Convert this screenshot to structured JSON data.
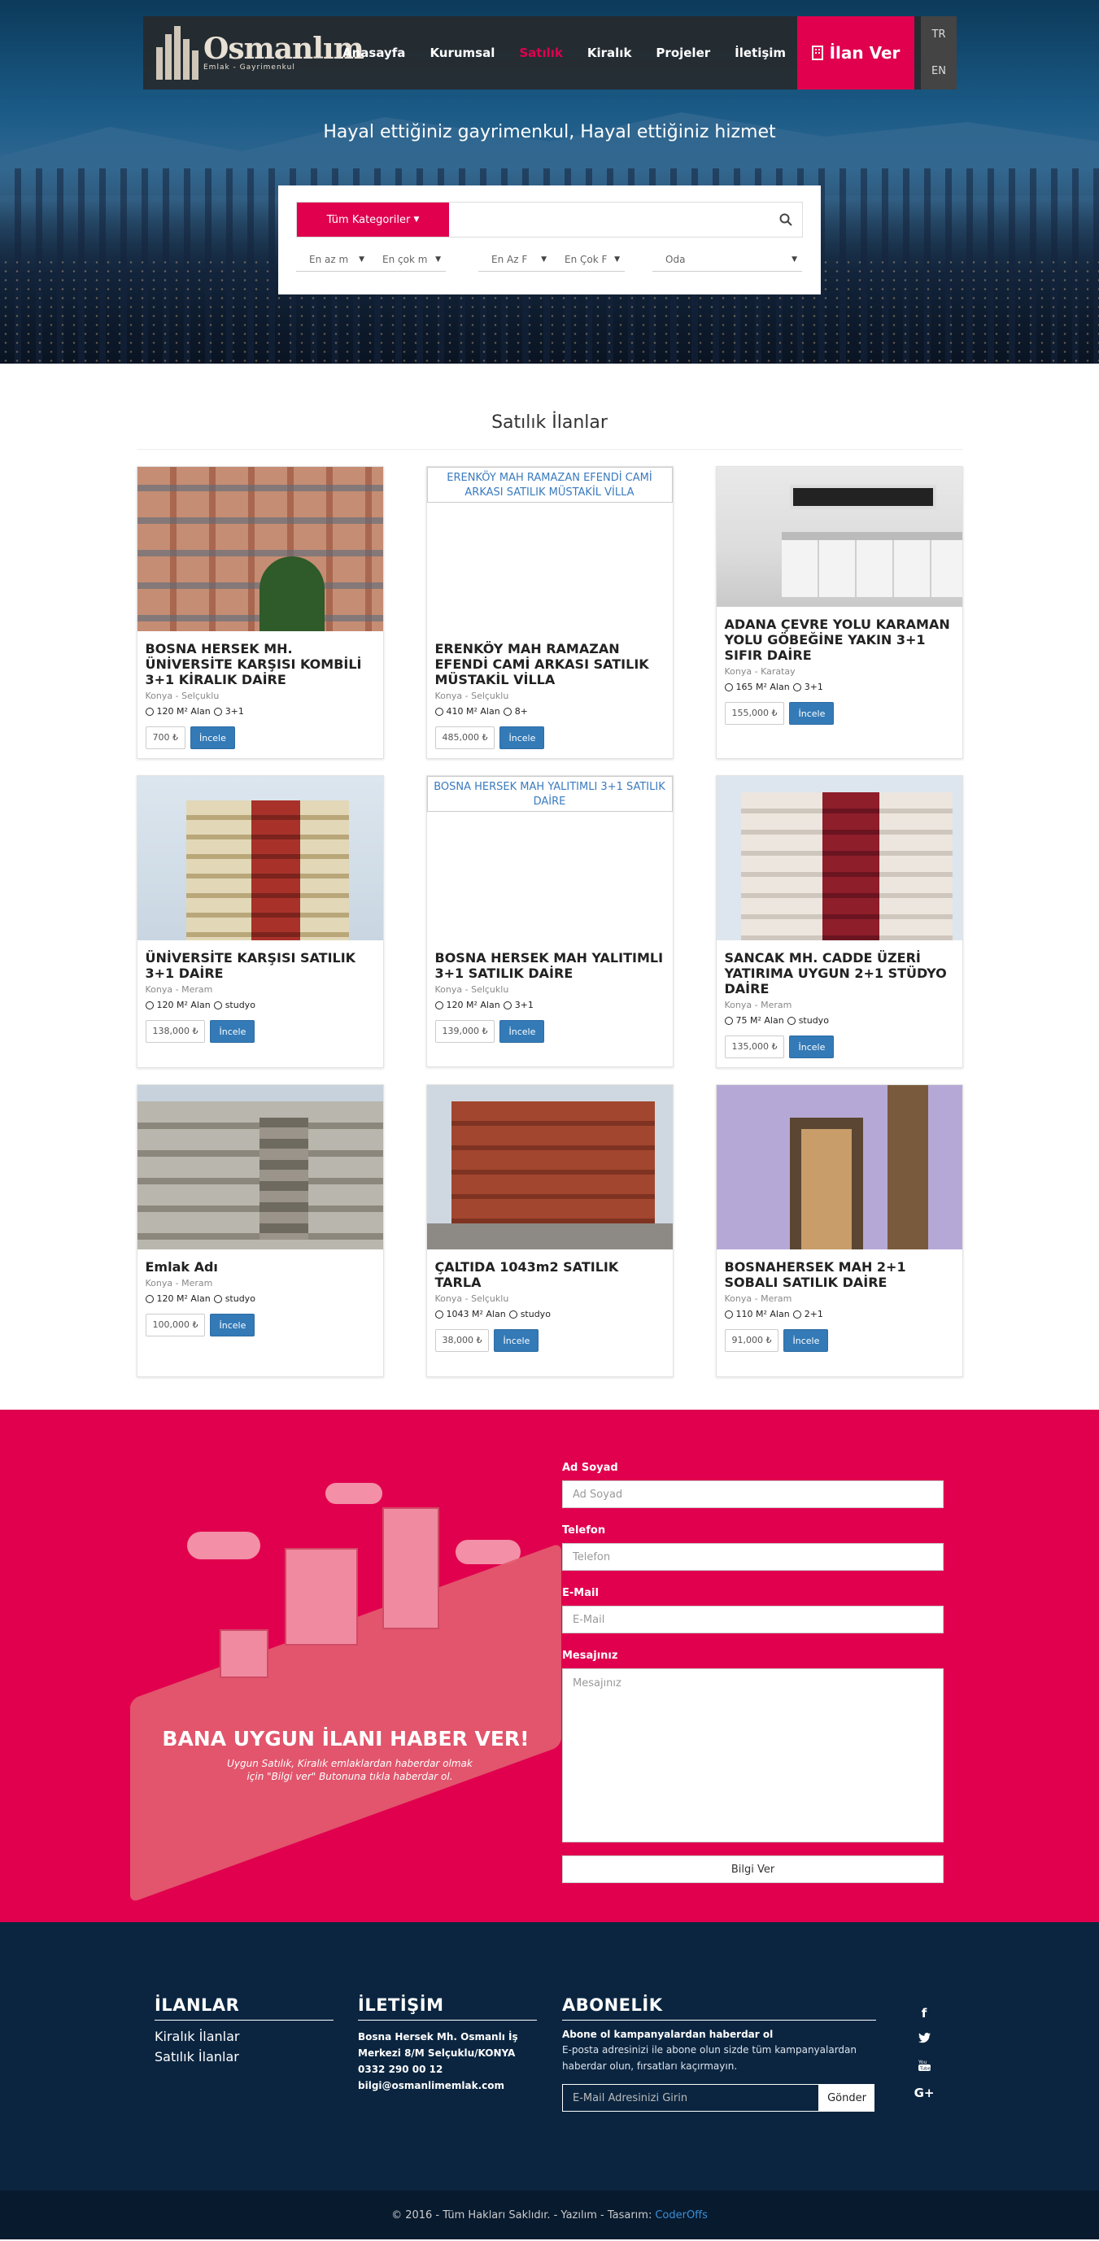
{
  "brand": {
    "logo_text": "Osmanlım",
    "logo_sub": "Emlak - Gayrimenkul",
    "accent": "#e0004e",
    "navy": "#0b2540"
  },
  "nav": {
    "items": [
      "Anasayfa",
      "Kurumsal",
      "Satılık",
      "Kiralık",
      "Projeler",
      "İletişim"
    ],
    "active": "Satılık",
    "ilan_ver": "İlan Ver",
    "langs": [
      "TR",
      "EN"
    ]
  },
  "hero": {
    "tagline": "Hayal ettiğiniz gayrimenkul, Hayal ettiğiniz hizmet"
  },
  "search": {
    "category_label": "Tüm Kategoriler",
    "input_value": "",
    "filters": [
      "En az m",
      "En çok m",
      "En Az F",
      "En Çok F",
      "Oda"
    ]
  },
  "listings": {
    "title": "Satılık İlanlar",
    "items": [
      {
        "name": "BOSNA HERSEK MH. ÜNİVERSİTE KARŞISI KOMBİLİ 3+1 KİRALIK DAİRE",
        "loc": "Konya - Selçuklu",
        "area": "120 M² Alan",
        "rooms": "3+1",
        "price": "700 ₺",
        "image_alt": ""
      },
      {
        "name": "ERENKÖY MAH RAMAZAN EFENDİ CAMİ ARKASI SATILIK MÜSTAKİL VİLLA",
        "loc": "Konya - Selçuklu",
        "area": "410 M² Alan",
        "rooms": "8+",
        "price": "485,000 ₺",
        "image_alt": "ERENKÖY MAH RAMAZAN EFENDİ CAMİ ARKASI SATILIK MÜSTAKİL VİLLA"
      },
      {
        "name": "ADANA ÇEVRE YOLU KARAMAN YOLU GÖBEĞİNE YAKIN 3+1 SIFIR DAİRE",
        "loc": "Konya - Karatay",
        "area": "165 M² Alan",
        "rooms": "3+1",
        "price": "155,000 ₺",
        "image_alt": ""
      },
      {
        "name": "ÜNİVERSİTE KARŞISI SATILIK 3+1 DAİRE",
        "loc": "Konya - Meram",
        "area": "120 M² Alan",
        "rooms": "studyo",
        "price": "138,000 ₺",
        "image_alt": ""
      },
      {
        "name": "BOSNA HERSEK MAH YALITIMLI 3+1 SATILIK DAİRE",
        "loc": "Konya - Selçuklu",
        "area": "120 M² Alan",
        "rooms": "3+1",
        "price": "139,000 ₺",
        "image_alt": "BOSNA HERSEK MAH YALITIMLI 3+1 SATILIK DAİRE"
      },
      {
        "name": "SANCAK MH. CADDE ÜZERİ YATIRIMA UYGUN 2+1 STÜDYO DAİRE",
        "loc": "Konya - Meram",
        "area": "75 M² Alan",
        "rooms": "studyo",
        "price": "135,000 ₺",
        "image_alt": ""
      },
      {
        "name": "Emlak Adı",
        "loc": "Konya - Meram",
        "area": "120 M² Alan",
        "rooms": "studyo",
        "price": "100,000 ₺",
        "image_alt": ""
      },
      {
        "name": "ÇALTIDA 1043m2 SATILIK TARLA",
        "loc": "Konya - Selçuklu",
        "area": "1043 M² Alan",
        "rooms": "studyo",
        "price": "38,000 ₺",
        "image_alt": ""
      },
      {
        "name": "BOSNAHERSEK MAH 2+1 SOBALI SATILIK DAİRE",
        "loc": "Konya - Meram",
        "area": "110 M² Alan",
        "rooms": "2+1",
        "price": "91,000 ₺",
        "image_alt": ""
      }
    ],
    "button_label": "İncele"
  },
  "contact": {
    "illus_title": "BANA UYGUN İLANI HABER VER!",
    "illus_sub": "Uygun Satılık, Kiralık emlaklardan haberdar olmak için \"Bilgi ver\" Butonuna tıkla haberdar ol.",
    "name_label": "Ad Soyad",
    "name_placeholder": "Ad Soyad",
    "phone_label": "Telefon",
    "phone_placeholder": "Telefon",
    "email_label": "E-Mail",
    "email_placeholder": "E-Mail",
    "message_label": "Mesajınız",
    "message_placeholder": "Mesajınız",
    "submit": "Bilgi Ver"
  },
  "footer": {
    "ilanlar_title": "İLANLAR",
    "ilanlar_links": [
      "Kiralık İlanlar",
      "Satılık İlanlar"
    ],
    "iletisim_title": "İLETİŞİM",
    "address_line1": "Bosna Hersek Mh. Osmanlı İş",
    "address_line2": "Merkezi 8/M Selçuklu/KONYA",
    "phone": "0332 290 00 12",
    "email": "bilgi@osmanlimemlak.com",
    "abonelik_title": "ABONELİK",
    "abonelik_head": "Abone ol kampanyalardan haberdar ol",
    "abonelik_text": "E-posta adresinizi ile abone olun sizde tüm kampanyalardan haberdar olun, fırsatları kaçırmayın.",
    "sub_placeholder": "E-Mail Adresinizi Girin",
    "sub_button": "Gönder",
    "social": [
      "facebook-icon",
      "twitter-icon",
      "youtube-icon",
      "google-plus-icon"
    ],
    "copyright": "© 2016 - Tüm Hakları Saklıdır. - Yazılım - Tasarım:",
    "credit": "CoderOffs"
  }
}
